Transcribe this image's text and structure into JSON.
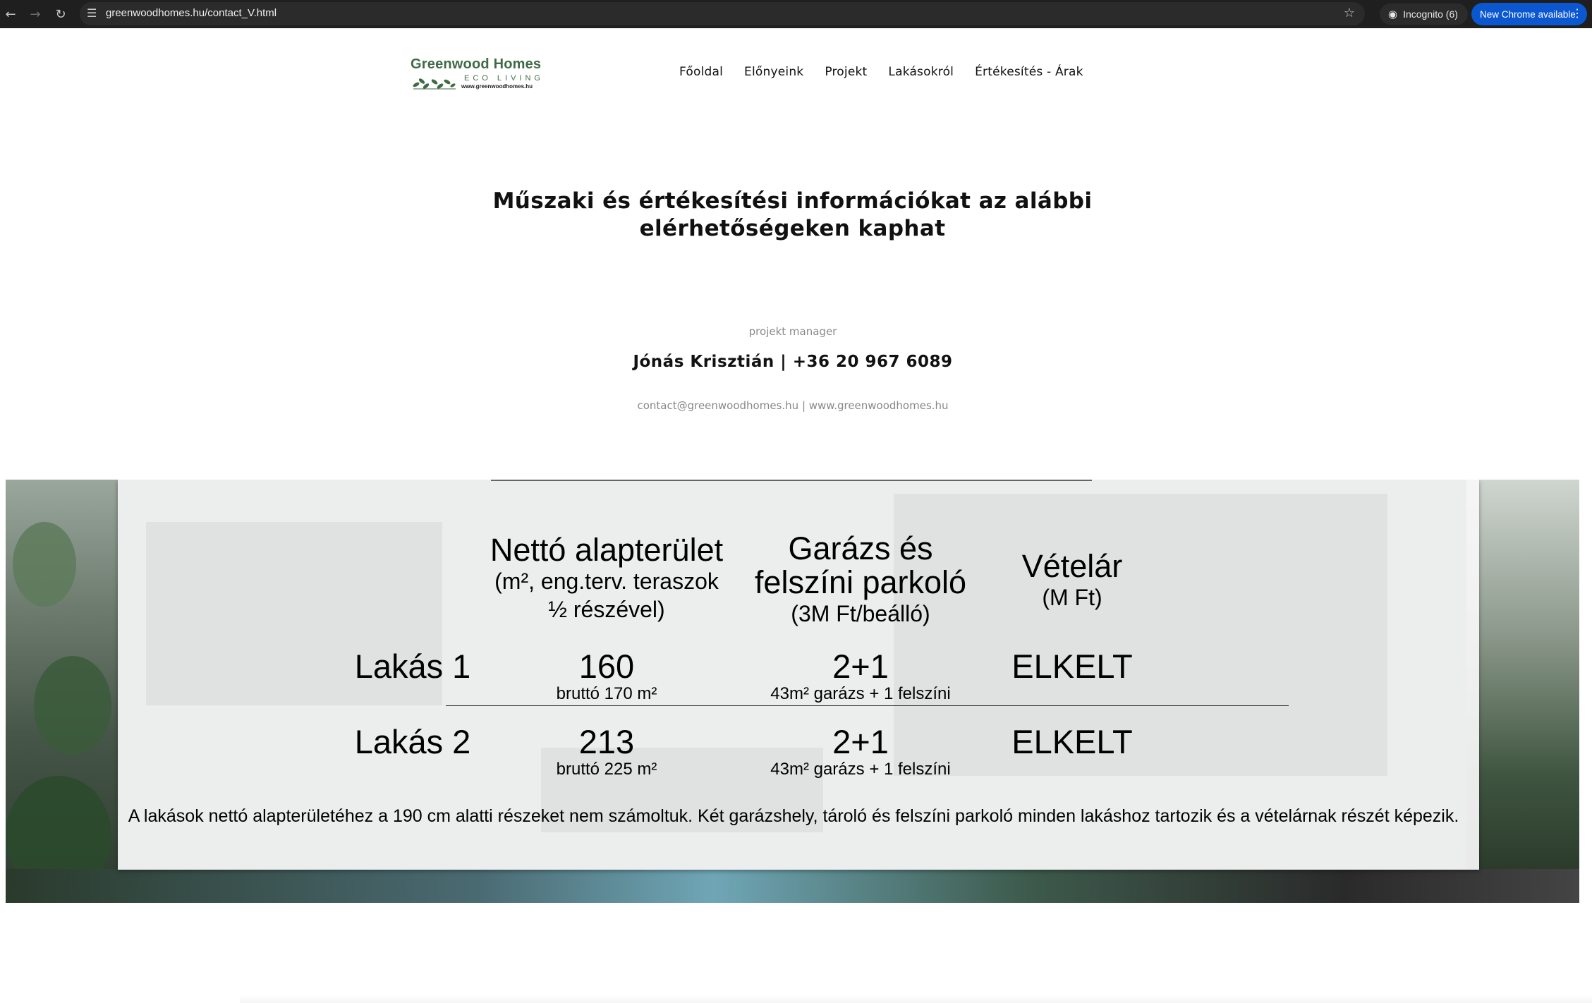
{
  "browser": {
    "url": "greenwoodhomes.hu/contact_V.html",
    "incognito_label": "Incognito (6)",
    "update_label": "New Chrome available"
  },
  "header": {
    "logo": {
      "name": "Greenwood Homes",
      "tagline": "ECO LIVING",
      "site": "www.greenwoodhomes.hu"
    },
    "nav": [
      {
        "label": "Főoldal"
      },
      {
        "label": "Előnyeink"
      },
      {
        "label": "Projekt"
      },
      {
        "label": "Lakásokról"
      },
      {
        "label": "Értékesítés - Árak"
      }
    ]
  },
  "contact": {
    "heading_line1": "Műszaki és értékesítési információkat az alábbi",
    "heading_line2": "elérhetőségeken kaphat",
    "role": "projekt manager",
    "name_phone": "Jónás Krisztián | +36 20 967 6089",
    "email_web": "contact@greenwoodhomes.hu | www.greenwoodhomes.hu"
  },
  "table": {
    "col_area": {
      "title": "Nettó alapterület",
      "sub1": "(m², eng.terv. teraszok",
      "sub2": "½ részével)"
    },
    "col_garage": {
      "title1": "Garázs és",
      "title2": "felszíni parkoló",
      "sub": "(3M Ft/beálló)"
    },
    "col_price": {
      "title": "Vételár",
      "sub": "(M Ft)"
    },
    "rows": [
      {
        "name": "Lakás 1",
        "area": "160",
        "gross": "bruttó 170 m²",
        "garage": "2+1",
        "garage_detail": "43m² garázs + 1 felszíni",
        "price": "ELKELT"
      },
      {
        "name": "Lakás 2",
        "area": "213",
        "gross": "bruttó 225 m²",
        "garage": "2+1",
        "garage_detail": "43m² garázs + 1 felszíni",
        "price": "ELKELT"
      }
    ],
    "note": "A lakások nettó alapterületéhez a 190 cm alatti részeket nem számoltuk. Két garázshely, tároló és felszíni parkoló minden lakáshoz tartozik és a vételárnak részét képezik."
  }
}
